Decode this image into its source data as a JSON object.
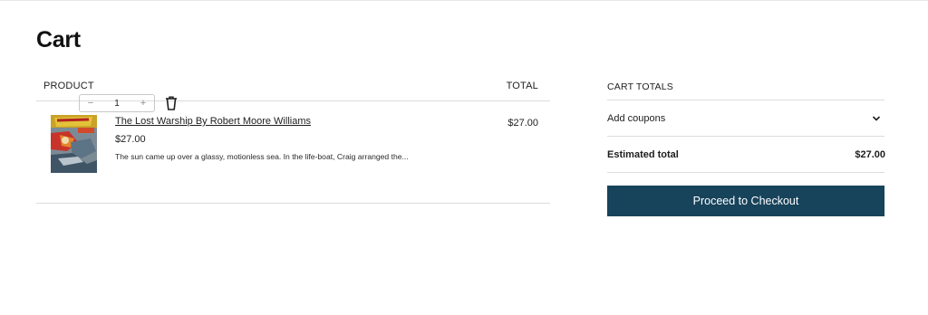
{
  "page": {
    "title": "Cart"
  },
  "table": {
    "header_product": "PRODUCT",
    "header_total": "TOTAL",
    "items": [
      {
        "name": "The Lost Warship By Robert Moore Williams",
        "price": "$27.00",
        "description": "The sun came up over a glassy, motionless sea. In the life-boat, Craig arranged the...",
        "quantity": "1",
        "decrement_symbol": "−",
        "increment_symbol": "+",
        "line_total": "$27.00",
        "thumbnail_icon": "book-cover-image",
        "remove_icon": "trash-icon"
      }
    ]
  },
  "totals": {
    "header": "CART TOTALS",
    "coupons_label": "Add coupons",
    "coupons_icon": "chevron-down-icon",
    "estimated_label": "Estimated total",
    "estimated_value": "$27.00",
    "checkout_label": "Proceed to Checkout",
    "button_color": "#17435b"
  }
}
